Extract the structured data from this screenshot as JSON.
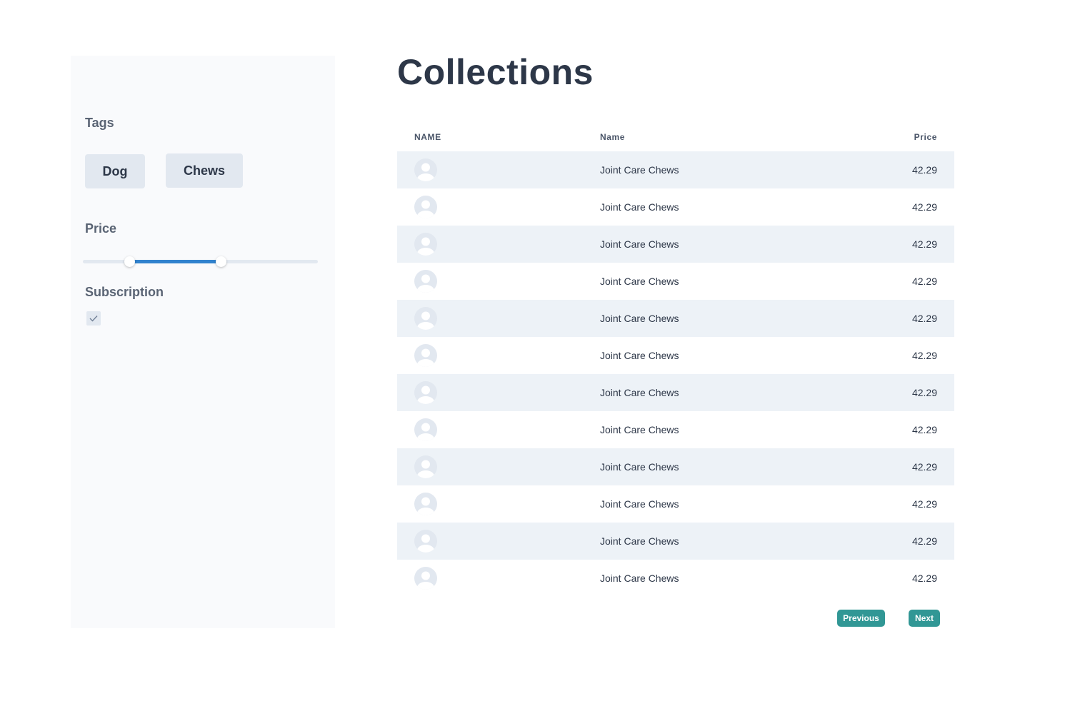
{
  "header": {
    "title": "Collections"
  },
  "sidebar": {
    "tags_heading": "Tags",
    "tags": [
      "Dog",
      "Chews"
    ],
    "price_heading": "Price",
    "price_range": {
      "min": 0.2,
      "max": 0.59
    },
    "subscription_heading": "Subscription",
    "subscription_checked": true
  },
  "table": {
    "columns": [
      "NAME",
      "Name",
      "Price"
    ],
    "rows": [
      {
        "avatar": "user-icon",
        "name": "Joint Care Chews",
        "price": "42.29"
      },
      {
        "avatar": "user-icon",
        "name": "Joint Care Chews",
        "price": "42.29"
      },
      {
        "avatar": "user-icon",
        "name": "Joint Care Chews",
        "price": "42.29"
      },
      {
        "avatar": "user-icon",
        "name": "Joint Care Chews",
        "price": "42.29"
      },
      {
        "avatar": "user-icon",
        "name": "Joint Care Chews",
        "price": "42.29"
      },
      {
        "avatar": "user-icon",
        "name": "Joint Care Chews",
        "price": "42.29"
      },
      {
        "avatar": "user-icon",
        "name": "Joint Care Chews",
        "price": "42.29"
      },
      {
        "avatar": "user-icon",
        "name": "Joint Care Chews",
        "price": "42.29"
      },
      {
        "avatar": "user-icon",
        "name": "Joint Care Chews",
        "price": "42.29"
      },
      {
        "avatar": "user-icon",
        "name": "Joint Care Chews",
        "price": "42.29"
      },
      {
        "avatar": "user-icon",
        "name": "Joint Care Chews",
        "price": "42.29"
      },
      {
        "avatar": "user-icon",
        "name": "Joint Care Chews",
        "price": "42.29"
      }
    ]
  },
  "pagination": {
    "previous_label": "Previous",
    "next_label": "Next"
  },
  "colors": {
    "accent": "#319795",
    "slider_fill": "#3182ce",
    "stripe": "#edf2f7",
    "sidebar_bg": "#f9fafc"
  }
}
